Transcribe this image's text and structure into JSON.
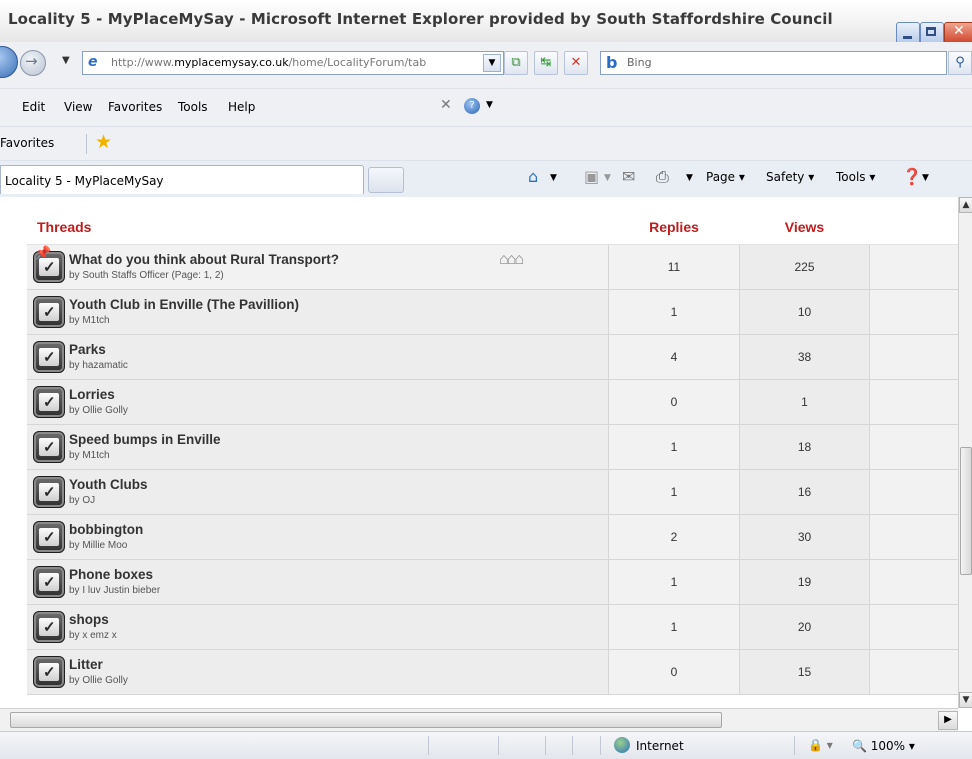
{
  "window": {
    "title": "Locality 5 - MyPlaceMySay - Microsoft Internet Explorer provided by South Staffordshire Council"
  },
  "address": {
    "url_prefix": "http://www.",
    "url_domain": "myplacemysay.co.uk",
    "url_path": "/home/LocalityForum/tab",
    "search_placeholder": "Bing"
  },
  "menu": {
    "items": [
      "Edit",
      "View",
      "Favorites",
      "Tools",
      "Help"
    ]
  },
  "favorites_bar": {
    "label": "Favorites"
  },
  "tabs": {
    "active_tab": "Locality 5 - MyPlaceMySay"
  },
  "command_bar": {
    "page": "Page",
    "safety": "Safety",
    "tools": "Tools"
  },
  "forum": {
    "headers": {
      "threads": "Threads",
      "replies": "Replies",
      "views": "Views"
    },
    "threads": [
      {
        "title": "What do you think about Rural Transport?",
        "author": "by South Staffs Officer (Page: 1, 2)",
        "replies": "11",
        "views": "225"
      },
      {
        "title": "Youth Club in Enville (The Pavillion)",
        "author": "by M1tch",
        "replies": "1",
        "views": "10"
      },
      {
        "title": "Parks",
        "author": "by hazamatic",
        "replies": "4",
        "views": "38"
      },
      {
        "title": "Lorries",
        "author": "by Ollie Golly",
        "replies": "0",
        "views": "1"
      },
      {
        "title": "Speed bumps in Enville",
        "author": "by M1tch",
        "replies": "1",
        "views": "18"
      },
      {
        "title": "Youth Clubs",
        "author": "by OJ",
        "replies": "1",
        "views": "16"
      },
      {
        "title": "bobbington",
        "author": "by Millie Moo",
        "replies": "2",
        "views": "30"
      },
      {
        "title": "Phone boxes",
        "author": "by I luv Justin bieber",
        "replies": "1",
        "views": "19"
      },
      {
        "title": "shops",
        "author": "by x emz x",
        "replies": "1",
        "views": "20"
      },
      {
        "title": "Litter",
        "author": "by Ollie Golly",
        "replies": "0",
        "views": "15"
      }
    ]
  },
  "status_bar": {
    "zone": "Internet",
    "zoom": "100%"
  },
  "colors": {
    "header_red": "#bf1c1c"
  }
}
